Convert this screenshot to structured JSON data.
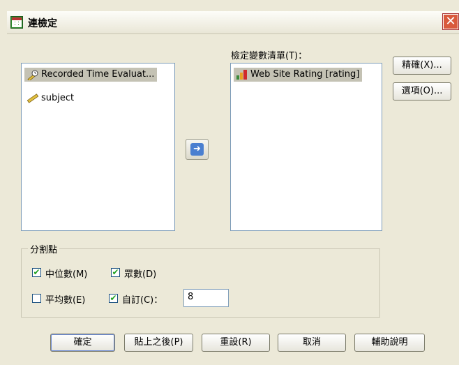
{
  "window": {
    "title": "連檢定",
    "close_glyph": "✕"
  },
  "source_list": {
    "items": [
      {
        "label": "Recorded Time Evaluat...",
        "icon": "scale-ruler-icon",
        "selected": true
      },
      {
        "label": "subject",
        "icon": "ruler-icon",
        "selected": false
      }
    ]
  },
  "move_button": {
    "glyph": "➜"
  },
  "test_list": {
    "label": "檢定變數清單(T)：",
    "items": [
      {
        "label": "Web Site Rating [rating]",
        "icon": "ordinal-bar-icon",
        "selected": true
      }
    ]
  },
  "side_buttons": {
    "exact": "精確(X)...",
    "options": "選項(O)..."
  },
  "cut_point": {
    "title": "分割點",
    "median": {
      "label": "中位數(M)",
      "checked": true
    },
    "mode": {
      "label": "眾數(D)",
      "checked": true
    },
    "mean": {
      "label": "平均數(E)",
      "checked": false
    },
    "custom": {
      "label": "自訂(C)：",
      "checked": true,
      "value": "8"
    }
  },
  "footer_buttons": {
    "ok": "確定",
    "paste": "貼上之後(P)",
    "reset": "重設(R)",
    "cancel": "取消",
    "help": "輔助說明"
  },
  "colors": {
    "accent": "#4a7fd0",
    "close": "#d95a3d",
    "check": "#21a121",
    "dialog_bg": "#ece9d8"
  }
}
